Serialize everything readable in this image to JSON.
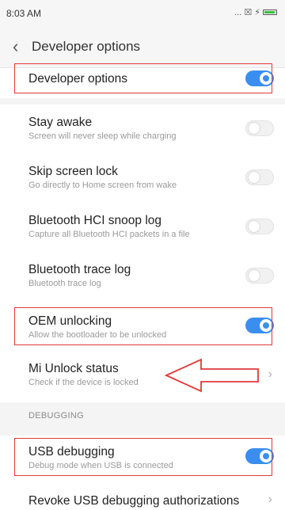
{
  "status_bar": {
    "time": "8:03 AM",
    "icons": "... ☒ ⚡"
  },
  "header": {
    "back_glyph": "‹",
    "title": "Developer options"
  },
  "master": {
    "title": "Developer options",
    "enabled": true
  },
  "items": [
    {
      "title": "Stay awake",
      "subtitle": "Screen will never sleep while charging",
      "enabled": false
    },
    {
      "title": "Skip screen lock",
      "subtitle": "Go directly to Home screen from wake",
      "enabled": false
    },
    {
      "title": "Bluetooth HCI snoop log",
      "subtitle": "Capture all Bluetooth HCI packets in a file",
      "enabled": false
    },
    {
      "title": "Bluetooth trace log",
      "subtitle": "Bluetooth trace log",
      "enabled": false
    },
    {
      "title": "OEM unlocking",
      "subtitle": "Allow the bootloader to be unlocked",
      "enabled": true
    },
    {
      "title": "Mi Unlock status",
      "subtitle": "Check if the device is locked"
    }
  ],
  "debugging": {
    "section_label": "DEBUGGING",
    "usb_debugging": {
      "title": "USB debugging",
      "subtitle": "Debug mode when USB is connected",
      "enabled": true
    },
    "revoke": {
      "title": "Revoke USB debugging authorizations"
    }
  },
  "colors": {
    "toggle_on": "#3a8ef0",
    "highlight": "#e03a3a",
    "battery": "#39c23e"
  }
}
